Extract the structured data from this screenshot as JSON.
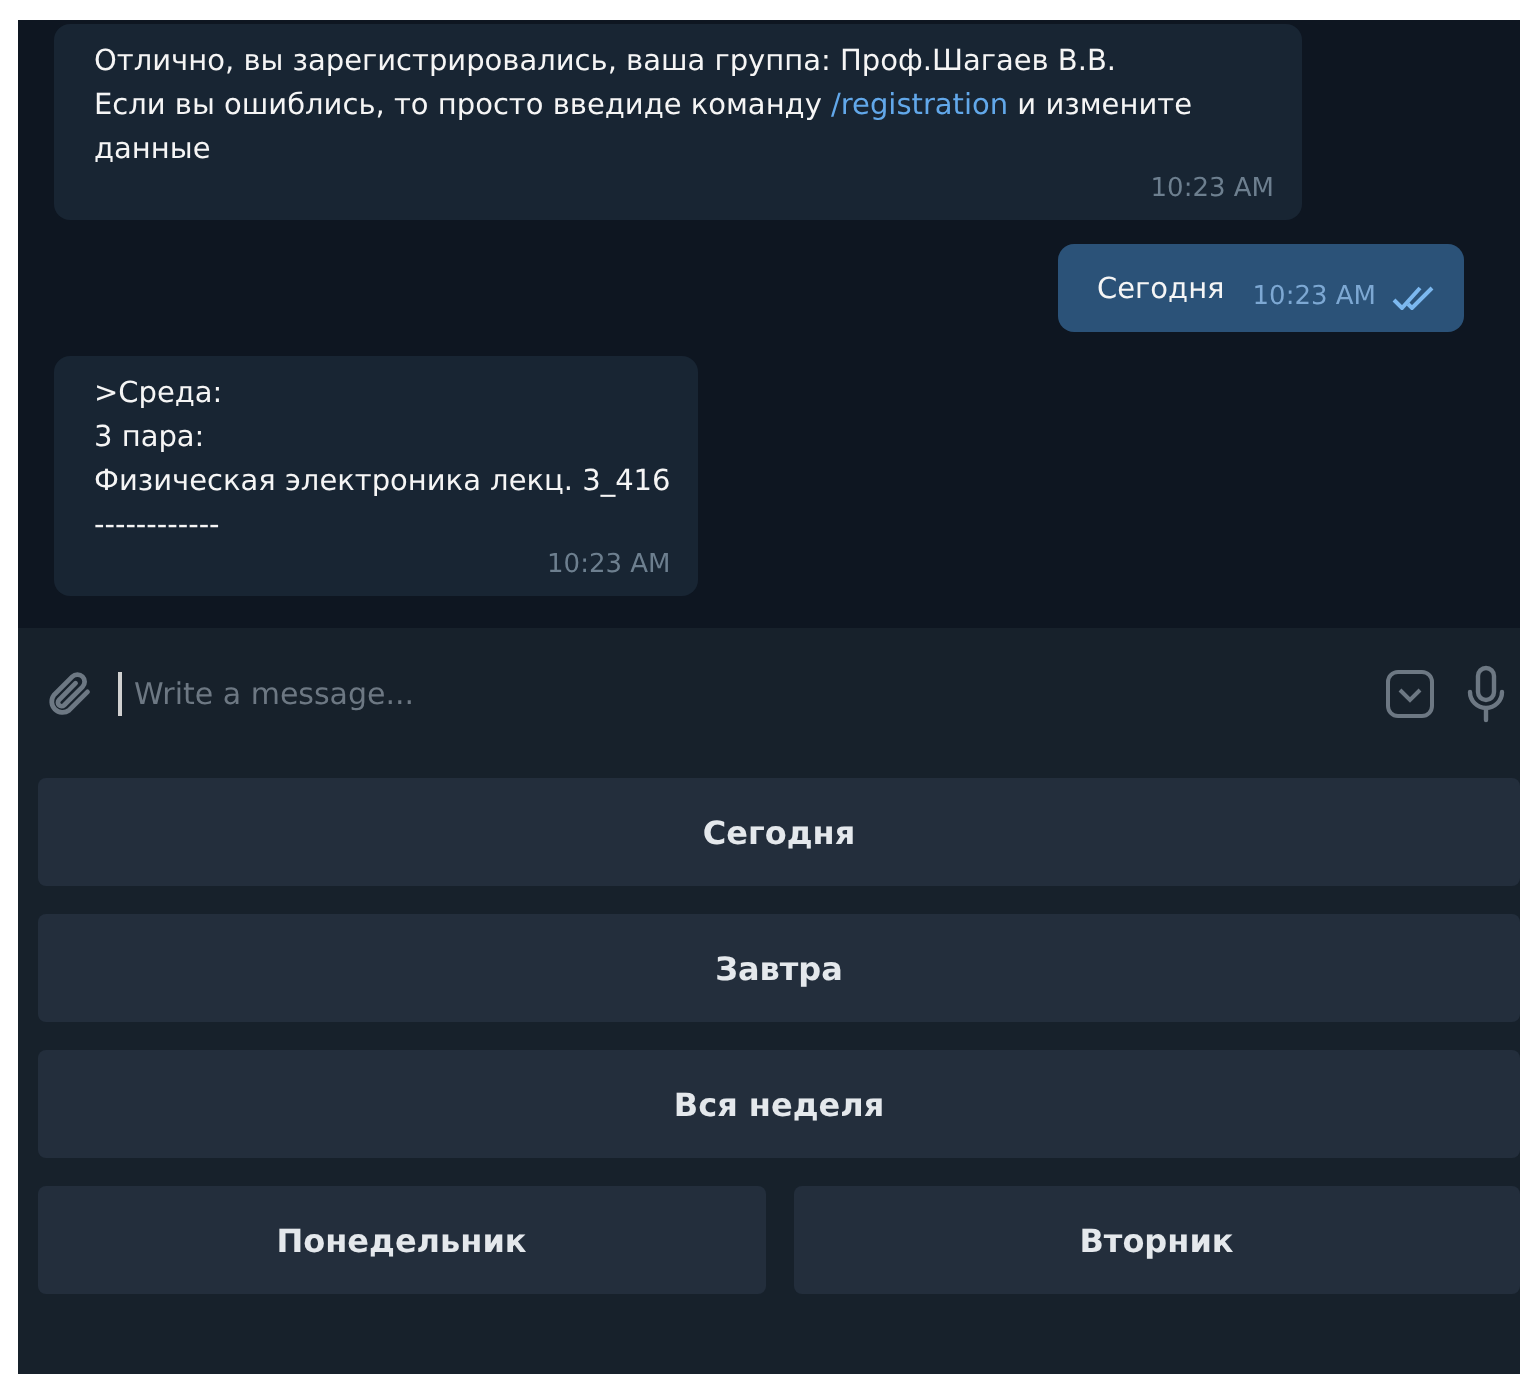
{
  "messages": [
    {
      "kind": "incoming",
      "paragraphs": [
        {
          "text": "Отлично, вы зарегистрировались, ваша группа: Проф.Шагаев В.В."
        },
        {
          "text": "Если вы ошиблись, то просто введиде команду ",
          "link": "/registration",
          "after": " и измените данные"
        }
      ],
      "time": "10:23 AM"
    },
    {
      "kind": "outgoing",
      "paragraphs": [
        {
          "text": "Сегодня"
        }
      ],
      "time": "10:23 AM",
      "read": true
    },
    {
      "kind": "incoming",
      "paragraphs": [
        {
          "text": ">Среда:"
        },
        {
          "text": "3 пара:"
        },
        {
          "text": "Физическая электроника лекц. 3_416"
        },
        {
          "text": "------------"
        }
      ],
      "time": "10:23 AM"
    }
  ],
  "composer": {
    "placeholder": "Write a message..."
  },
  "keyboard": [
    [
      "Сегодня"
    ],
    [
      "Завтра"
    ],
    [
      "Вся неделя"
    ],
    [
      "Понедельник",
      "Вторник"
    ]
  ]
}
